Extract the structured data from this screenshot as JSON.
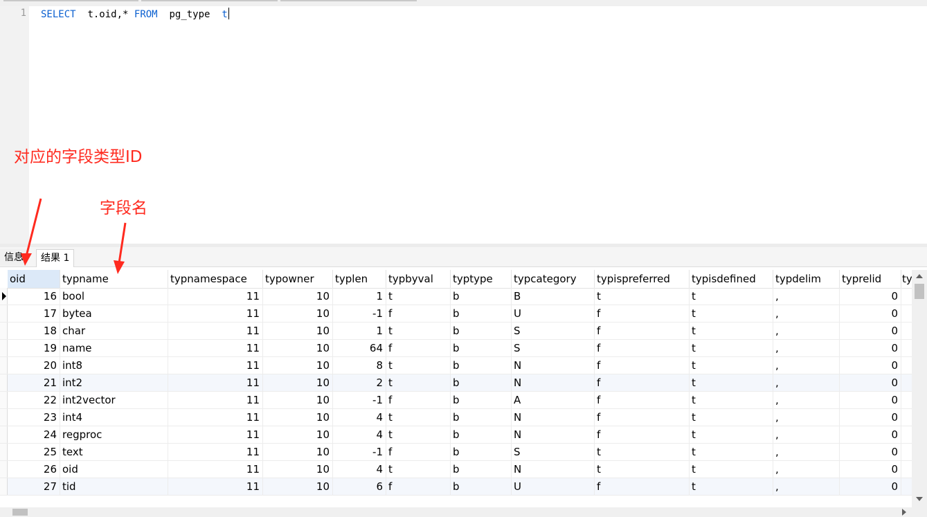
{
  "editor": {
    "line_number": "1",
    "sql": {
      "kw_select": "SELECT",
      "cols": "t.oid,*",
      "kw_from": "FROM",
      "table": "pg_type",
      "alias": "t"
    }
  },
  "annotations": {
    "type_id": "对应的字段类型ID",
    "field_name": "字段名"
  },
  "result_tabs": {
    "info": "信息",
    "result": "结果 1"
  },
  "grid": {
    "columns": [
      "oid",
      "typname",
      "typnamespace",
      "typowner",
      "typlen",
      "typbyval",
      "typtype",
      "typcategory",
      "typispreferred",
      "typisdefined",
      "typdelim",
      "typrelid",
      "ty"
    ],
    "rows": [
      [
        "16",
        "bool",
        "11",
        "10",
        "1",
        "t",
        "b",
        "B",
        "t",
        "t",
        ",",
        "0"
      ],
      [
        "17",
        "bytea",
        "11",
        "10",
        "-1",
        "f",
        "b",
        "U",
        "f",
        "t",
        ",",
        "0"
      ],
      [
        "18",
        "char",
        "11",
        "10",
        "1",
        "t",
        "b",
        "S",
        "f",
        "t",
        ",",
        "0"
      ],
      [
        "19",
        "name",
        "11",
        "10",
        "64",
        "f",
        "b",
        "S",
        "f",
        "t",
        ",",
        "0"
      ],
      [
        "20",
        "int8",
        "11",
        "10",
        "8",
        "t",
        "b",
        "N",
        "f",
        "t",
        ",",
        "0"
      ],
      [
        "21",
        "int2",
        "11",
        "10",
        "2",
        "t",
        "b",
        "N",
        "f",
        "t",
        ",",
        "0"
      ],
      [
        "22",
        "int2vector",
        "11",
        "10",
        "-1",
        "f",
        "b",
        "A",
        "f",
        "t",
        ",",
        "0"
      ],
      [
        "23",
        "int4",
        "11",
        "10",
        "4",
        "t",
        "b",
        "N",
        "f",
        "t",
        ",",
        "0"
      ],
      [
        "24",
        "regproc",
        "11",
        "10",
        "4",
        "t",
        "b",
        "N",
        "f",
        "t",
        ",",
        "0"
      ],
      [
        "25",
        "text",
        "11",
        "10",
        "-1",
        "f",
        "b",
        "S",
        "t",
        "t",
        ",",
        "0"
      ],
      [
        "26",
        "oid",
        "11",
        "10",
        "4",
        "t",
        "b",
        "N",
        "t",
        "t",
        ",",
        "0"
      ],
      [
        "27",
        "tid",
        "11",
        "10",
        "6",
        "f",
        "b",
        "U",
        "f",
        "t",
        ",",
        "0"
      ]
    ]
  },
  "colors": {
    "keyword": "#0a5fd0",
    "annotation": "#ff2a1f",
    "selected_header": "#dce9f8"
  }
}
